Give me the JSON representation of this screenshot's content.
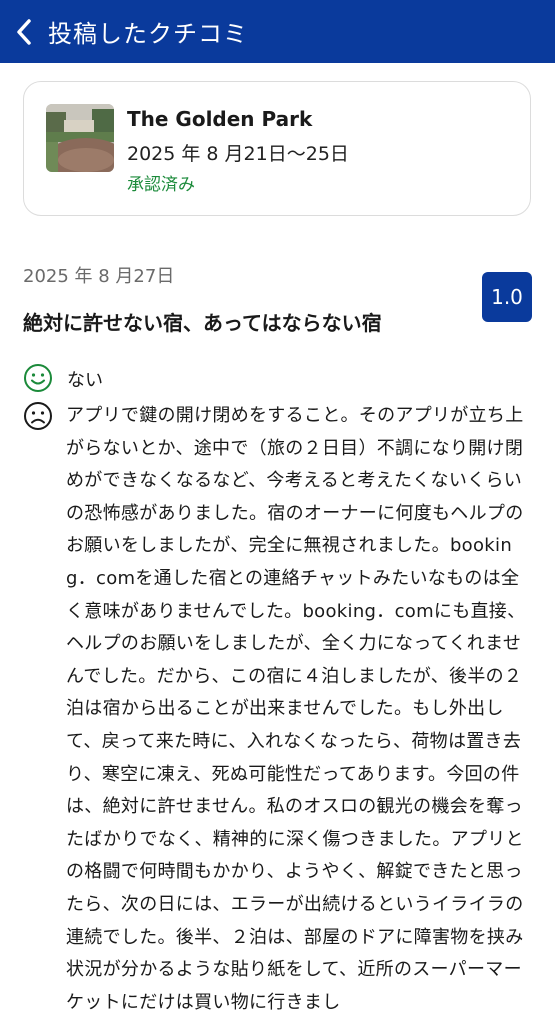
{
  "header": {
    "title": "投稿したクチコミ",
    "back_icon": "chevron-left-icon",
    "background": "#0a3a9c"
  },
  "hotel": {
    "name": "The Golden Park",
    "dates": "2025 年 8 月21日〜25日",
    "status": "承認済み",
    "status_color": "#1b8a3a"
  },
  "review": {
    "date": "2025 年 8 月27日",
    "score": "1.0",
    "title": "絶対に許せない宿、あってはならない宿",
    "positive_icon": "smile-icon",
    "positive_text": "ない",
    "negative_icon": "frown-icon",
    "negative_text": "アプリで鍵の開け閉めをすること。そのアプリが立ち上がらないとか、途中で（旅の２日目）不調になり開け閉めができなくなるなど、今考えると考えたくないくらいの恐怖感がありました。宿のオーナーに何度もヘルプのお願いをしましたが、完全に無視されました。booking．comを通した宿との連絡チャットみたいなものは全く意味がありませんでした。booking．comにも直接、ヘルプのお願いをしましたが、全く力になってくれませんでした。だから、この宿に４泊しましたが、後半の２泊は宿から出ることが出来ませんでした。もし外出して、戻って来た時に、入れなくなったら、荷物は置き去り、寒空に凍え、死ぬ可能性だってあります。今回の件は、絶対に許せません。私のオスロの観光の機会を奪ったばかりでなく、精神的に深く傷つきました。アプリとの格闘で何時間もかかり、ようやく、解錠できたと思ったら、次の日には、エラーが出続けるというイライラの連続でした。後半、２泊は、部屋のドアに障害物を挟み状況が分かるような貼り紙をして、近所のスーパーマーケットにだけは買い物に行きまし"
  }
}
